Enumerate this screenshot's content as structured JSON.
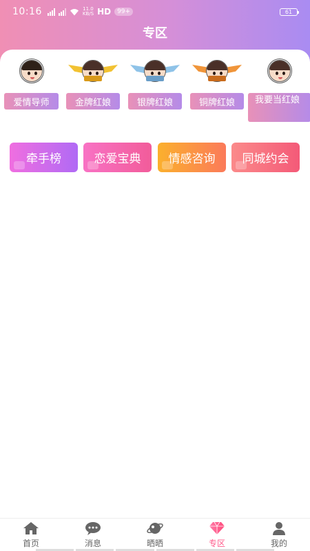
{
  "status_bar": {
    "time": "10:16",
    "net_speed_top": "11.0",
    "net_speed_bottom": "KB/S",
    "hd": "HD",
    "notification_count": "99+",
    "battery": "61"
  },
  "header": {
    "title": "专区"
  },
  "matchmakers": [
    {
      "label": "爱情导师",
      "icon": "love-mentor-avatar-icon",
      "wing_color": ""
    },
    {
      "label": "金牌红娘",
      "icon": "gold-matchmaker-badge-icon",
      "wing_color": "#f2c232"
    },
    {
      "label": "银牌红娘",
      "icon": "silver-matchmaker-badge-icon",
      "wing_color": "#8fc3e8"
    },
    {
      "label": "铜牌红娘",
      "icon": "bronze-matchmaker-badge-icon",
      "wing_color": "#f0953a"
    },
    {
      "label": "我要当红娘",
      "icon": "become-matchmaker-avatar-icon",
      "wing_color": ""
    }
  ],
  "categories": [
    {
      "label": "牵手榜",
      "color_from": "#f06ee0",
      "color_to": "#b06af5"
    },
    {
      "label": "恋爱宝典",
      "color_from": "#f872c4",
      "color_to": "#f25c9a"
    },
    {
      "label": "情感咨询",
      "color_from": "#fbb02d",
      "color_to": "#fb7a5a"
    },
    {
      "label": "同城约会",
      "color_from": "#fb8a8a",
      "color_to": "#f45a78"
    }
  ],
  "tabbar": {
    "active_color": "#ff5a8a",
    "items": [
      {
        "label": "首页",
        "icon": "home-icon"
      },
      {
        "label": "消息",
        "icon": "chat-bubble-icon"
      },
      {
        "label": "晒晒",
        "icon": "planet-icon"
      },
      {
        "label": "专区",
        "icon": "diamond-icon"
      },
      {
        "label": "我的",
        "icon": "person-icon"
      }
    ]
  }
}
